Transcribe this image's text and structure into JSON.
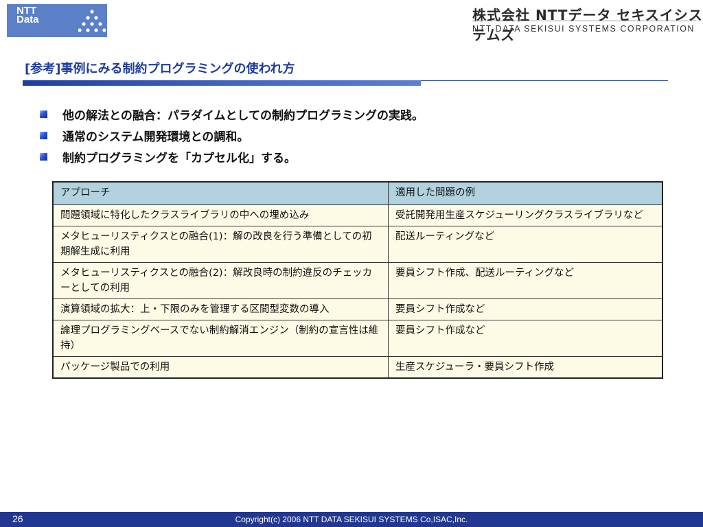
{
  "header": {
    "logo_text_line1": "NTT",
    "logo_text_line2": "Data",
    "logo_color": "#5b80c8",
    "company_jp": "株式会社 NTTデータ セキスイシステムズ",
    "company_en": "NTT DATA SEKISUI SYSTEMS CORPORATION"
  },
  "title": "[参考]事例にみる制約プログラミングの使われ方",
  "bullets": [
    "他の解法との融合：パラダイムとしての制約プログラミングの実践。",
    "通常のシステム開発環境との調和。",
    "制約プログラミングを「カプセル化」する。"
  ],
  "table": {
    "headers": [
      "アプローチ",
      "適用した問題の例"
    ],
    "rows": [
      [
        "問題領域に特化したクラスライブラリの中への埋め込み",
        "受託開発用生産スケジューリングクラスライブラリなど"
      ],
      [
        "メタヒューリスティクスとの融合(1)：解の改良を行う準備としての初期解生成に利用",
        "配送ルーティングなど"
      ],
      [
        "メタヒューリスティクスとの融合(2)：解改良時の制約違反のチェッカーとしての利用",
        "要員シフト作成、配送ルーティングなど"
      ],
      [
        "演算領域の拡大：上・下限のみを管理する区間型変数の導入",
        "要員シフト作成など"
      ],
      [
        "論理プログラミングベースでない制約解消エンジン（制約の宣言性は維持）",
        "要員シフト作成など"
      ],
      [
        "パッケージ製品での利用",
        "生産スケジューラ・要員シフト作成"
      ]
    ],
    "header_color": "#b2d2df",
    "cell_color": "#fdfbe6"
  },
  "footer": {
    "page_number": "26",
    "copyright": "Copyright(c) 2006 NTT DATA SEKISUI SYSTEMS Co,ISAC,Inc.",
    "bar_color": "#22378f"
  }
}
